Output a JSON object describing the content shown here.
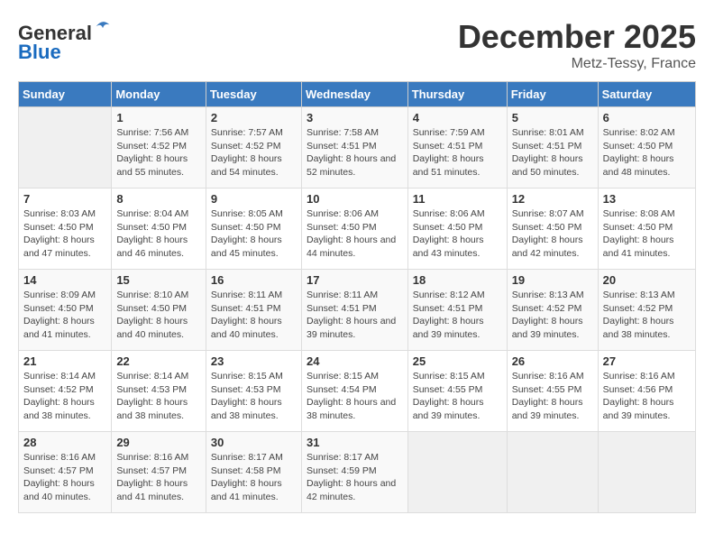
{
  "header": {
    "logo_line1": "General",
    "logo_line2": "Blue",
    "month": "December 2025",
    "location": "Metz-Tessy, France"
  },
  "weekdays": [
    "Sunday",
    "Monday",
    "Tuesday",
    "Wednesday",
    "Thursday",
    "Friday",
    "Saturday"
  ],
  "weeks": [
    [
      {
        "day": "",
        "sunrise": "",
        "sunset": "",
        "daylight": ""
      },
      {
        "day": "1",
        "sunrise": "7:56 AM",
        "sunset": "4:52 PM",
        "daylight": "8 hours and 55 minutes."
      },
      {
        "day": "2",
        "sunrise": "7:57 AM",
        "sunset": "4:52 PM",
        "daylight": "8 hours and 54 minutes."
      },
      {
        "day": "3",
        "sunrise": "7:58 AM",
        "sunset": "4:51 PM",
        "daylight": "8 hours and 52 minutes."
      },
      {
        "day": "4",
        "sunrise": "7:59 AM",
        "sunset": "4:51 PM",
        "daylight": "8 hours and 51 minutes."
      },
      {
        "day": "5",
        "sunrise": "8:01 AM",
        "sunset": "4:51 PM",
        "daylight": "8 hours and 50 minutes."
      },
      {
        "day": "6",
        "sunrise": "8:02 AM",
        "sunset": "4:50 PM",
        "daylight": "8 hours and 48 minutes."
      }
    ],
    [
      {
        "day": "7",
        "sunrise": "8:03 AM",
        "sunset": "4:50 PM",
        "daylight": "8 hours and 47 minutes."
      },
      {
        "day": "8",
        "sunrise": "8:04 AM",
        "sunset": "4:50 PM",
        "daylight": "8 hours and 46 minutes."
      },
      {
        "day": "9",
        "sunrise": "8:05 AM",
        "sunset": "4:50 PM",
        "daylight": "8 hours and 45 minutes."
      },
      {
        "day": "10",
        "sunrise": "8:06 AM",
        "sunset": "4:50 PM",
        "daylight": "8 hours and 44 minutes."
      },
      {
        "day": "11",
        "sunrise": "8:06 AM",
        "sunset": "4:50 PM",
        "daylight": "8 hours and 43 minutes."
      },
      {
        "day": "12",
        "sunrise": "8:07 AM",
        "sunset": "4:50 PM",
        "daylight": "8 hours and 42 minutes."
      },
      {
        "day": "13",
        "sunrise": "8:08 AM",
        "sunset": "4:50 PM",
        "daylight": "8 hours and 41 minutes."
      }
    ],
    [
      {
        "day": "14",
        "sunrise": "8:09 AM",
        "sunset": "4:50 PM",
        "daylight": "8 hours and 41 minutes."
      },
      {
        "day": "15",
        "sunrise": "8:10 AM",
        "sunset": "4:50 PM",
        "daylight": "8 hours and 40 minutes."
      },
      {
        "day": "16",
        "sunrise": "8:11 AM",
        "sunset": "4:51 PM",
        "daylight": "8 hours and 40 minutes."
      },
      {
        "day": "17",
        "sunrise": "8:11 AM",
        "sunset": "4:51 PM",
        "daylight": "8 hours and 39 minutes."
      },
      {
        "day": "18",
        "sunrise": "8:12 AM",
        "sunset": "4:51 PM",
        "daylight": "8 hours and 39 minutes."
      },
      {
        "day": "19",
        "sunrise": "8:13 AM",
        "sunset": "4:52 PM",
        "daylight": "8 hours and 39 minutes."
      },
      {
        "day": "20",
        "sunrise": "8:13 AM",
        "sunset": "4:52 PM",
        "daylight": "8 hours and 38 minutes."
      }
    ],
    [
      {
        "day": "21",
        "sunrise": "8:14 AM",
        "sunset": "4:52 PM",
        "daylight": "8 hours and 38 minutes."
      },
      {
        "day": "22",
        "sunrise": "8:14 AM",
        "sunset": "4:53 PM",
        "daylight": "8 hours and 38 minutes."
      },
      {
        "day": "23",
        "sunrise": "8:15 AM",
        "sunset": "4:53 PM",
        "daylight": "8 hours and 38 minutes."
      },
      {
        "day": "24",
        "sunrise": "8:15 AM",
        "sunset": "4:54 PM",
        "daylight": "8 hours and 38 minutes."
      },
      {
        "day": "25",
        "sunrise": "8:15 AM",
        "sunset": "4:55 PM",
        "daylight": "8 hours and 39 minutes."
      },
      {
        "day": "26",
        "sunrise": "8:16 AM",
        "sunset": "4:55 PM",
        "daylight": "8 hours and 39 minutes."
      },
      {
        "day": "27",
        "sunrise": "8:16 AM",
        "sunset": "4:56 PM",
        "daylight": "8 hours and 39 minutes."
      }
    ],
    [
      {
        "day": "28",
        "sunrise": "8:16 AM",
        "sunset": "4:57 PM",
        "daylight": "8 hours and 40 minutes."
      },
      {
        "day": "29",
        "sunrise": "8:16 AM",
        "sunset": "4:57 PM",
        "daylight": "8 hours and 41 minutes."
      },
      {
        "day": "30",
        "sunrise": "8:17 AM",
        "sunset": "4:58 PM",
        "daylight": "8 hours and 41 minutes."
      },
      {
        "day": "31",
        "sunrise": "8:17 AM",
        "sunset": "4:59 PM",
        "daylight": "8 hours and 42 minutes."
      },
      {
        "day": "",
        "sunrise": "",
        "sunset": "",
        "daylight": ""
      },
      {
        "day": "",
        "sunrise": "",
        "sunset": "",
        "daylight": ""
      },
      {
        "day": "",
        "sunrise": "",
        "sunset": "",
        "daylight": ""
      }
    ]
  ]
}
